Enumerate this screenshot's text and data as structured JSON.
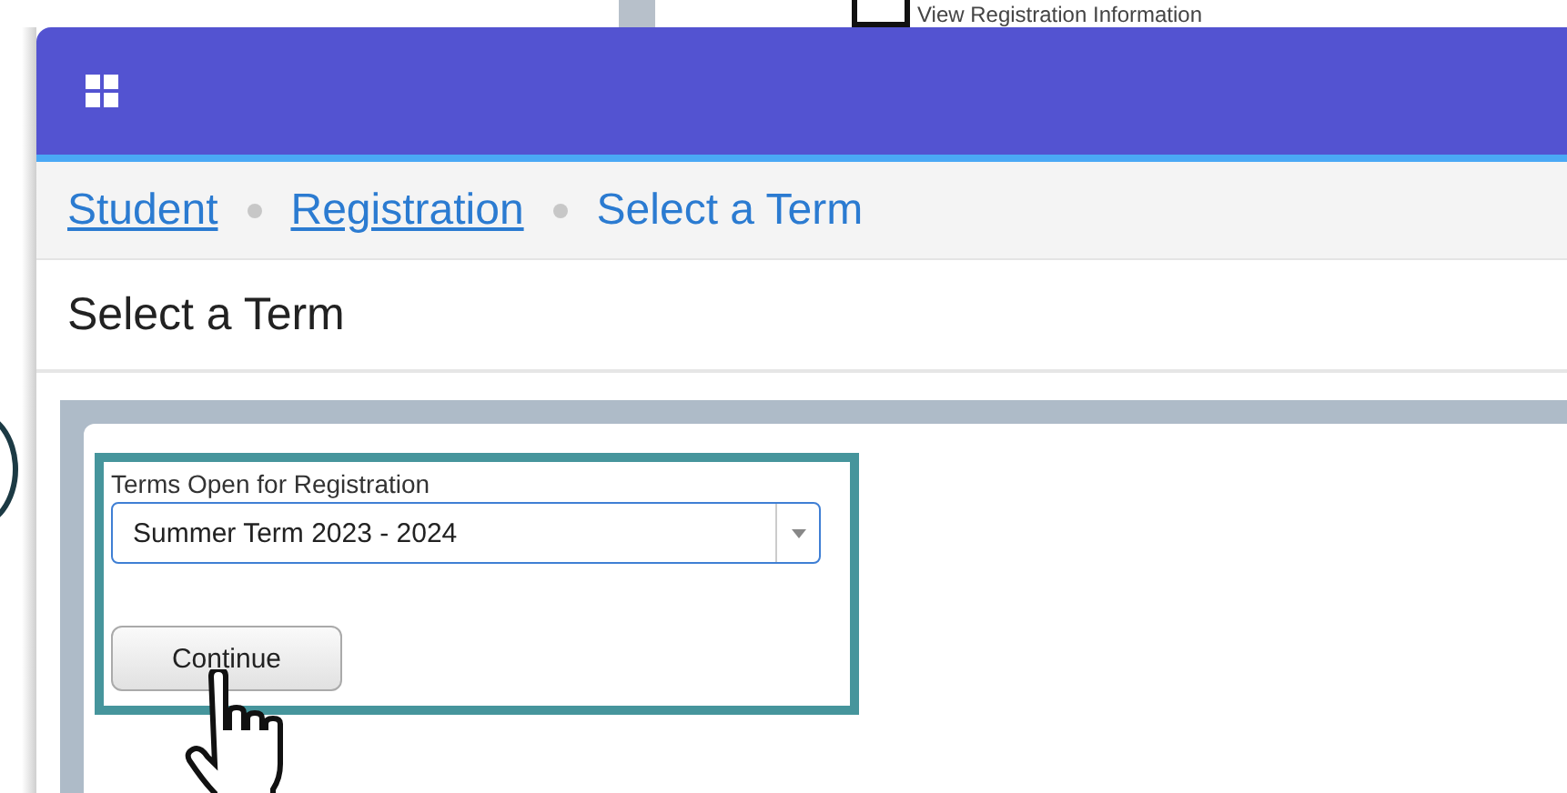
{
  "background_window": {
    "text": "View Registration Information"
  },
  "breadcrumbs": [
    {
      "label": "Student",
      "link": true
    },
    {
      "label": "Registration",
      "link": true
    },
    {
      "label": "Select a Term",
      "link": false
    }
  ],
  "page_title": "Select a Term",
  "form": {
    "label": "Terms Open for Registration",
    "value": "Summer Term 2023 - 2024",
    "button": "Continue"
  }
}
